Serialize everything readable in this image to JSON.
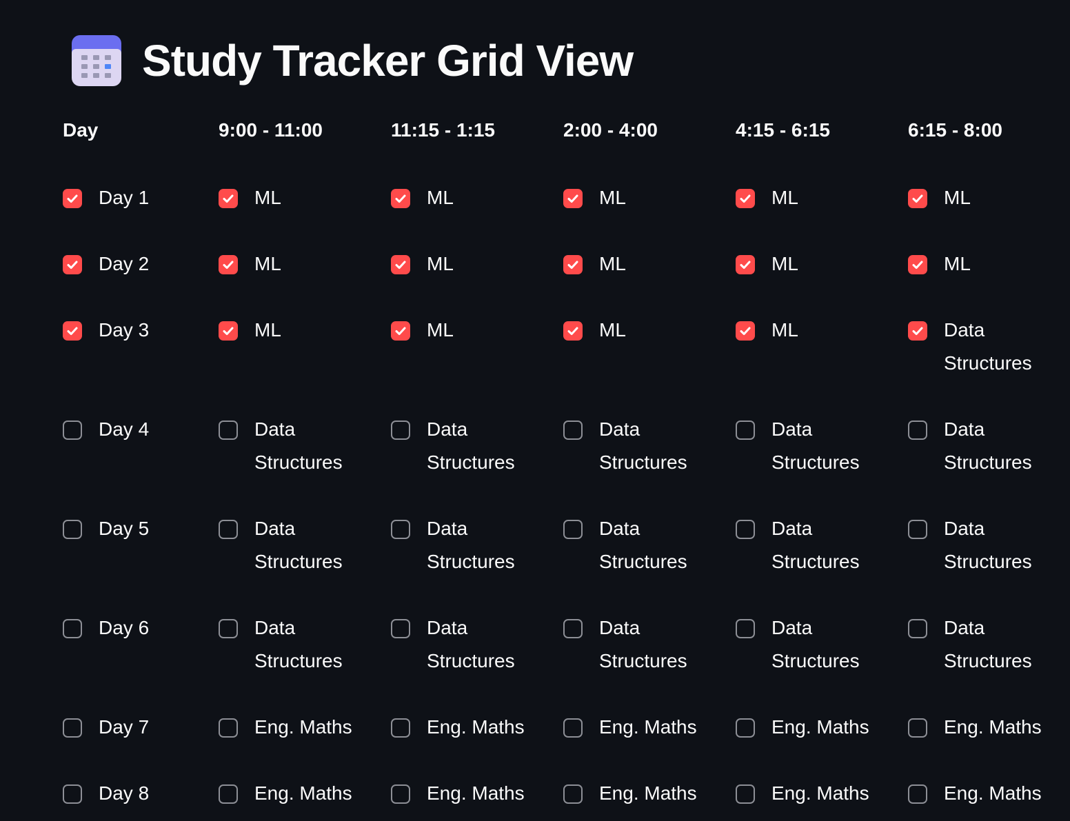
{
  "page": {
    "title": "Study Tracker Grid View",
    "title_icon": "calendar-icon"
  },
  "colors": {
    "background": "#0e1117",
    "checked": "#ff4b4b",
    "text": "#fafafa",
    "unchecked_border": "#8d8f96"
  },
  "grid": {
    "columns": [
      "Day",
      "9:00 - 11:00",
      "11:15 - 1:15",
      "2:00 - 4:00",
      "4:15 - 6:15",
      "6:15 - 8:00"
    ],
    "rows": [
      {
        "day": "Day 1",
        "day_checked": true,
        "slots": [
          {
            "label": "ML",
            "checked": true
          },
          {
            "label": "ML",
            "checked": true
          },
          {
            "label": "ML",
            "checked": true
          },
          {
            "label": "ML",
            "checked": true
          },
          {
            "label": "ML",
            "checked": true
          }
        ]
      },
      {
        "day": "Day 2",
        "day_checked": true,
        "slots": [
          {
            "label": "ML",
            "checked": true
          },
          {
            "label": "ML",
            "checked": true
          },
          {
            "label": "ML",
            "checked": true
          },
          {
            "label": "ML",
            "checked": true
          },
          {
            "label": "ML",
            "checked": true
          }
        ]
      },
      {
        "day": "Day 3",
        "day_checked": true,
        "slots": [
          {
            "label": "ML",
            "checked": true
          },
          {
            "label": "ML",
            "checked": true
          },
          {
            "label": "ML",
            "checked": true
          },
          {
            "label": "ML",
            "checked": true
          },
          {
            "label": "Data Structures",
            "checked": true
          }
        ]
      },
      {
        "day": "Day 4",
        "day_checked": false,
        "slots": [
          {
            "label": "Data Structures",
            "checked": false
          },
          {
            "label": "Data Structures",
            "checked": false
          },
          {
            "label": "Data Structures",
            "checked": false
          },
          {
            "label": "Data Structures",
            "checked": false
          },
          {
            "label": "Data Structures",
            "checked": false
          }
        ]
      },
      {
        "day": "Day 5",
        "day_checked": false,
        "slots": [
          {
            "label": "Data Structures",
            "checked": false
          },
          {
            "label": "Data Structures",
            "checked": false
          },
          {
            "label": "Data Structures",
            "checked": false
          },
          {
            "label": "Data Structures",
            "checked": false
          },
          {
            "label": "Data Structures",
            "checked": false
          }
        ]
      },
      {
        "day": "Day 6",
        "day_checked": false,
        "slots": [
          {
            "label": "Data Structures",
            "checked": false
          },
          {
            "label": "Data Structures",
            "checked": false
          },
          {
            "label": "Data Structures",
            "checked": false
          },
          {
            "label": "Data Structures",
            "checked": false
          },
          {
            "label": "Data Structures",
            "checked": false
          }
        ]
      },
      {
        "day": "Day 7",
        "day_checked": false,
        "slots": [
          {
            "label": "Eng. Maths",
            "checked": false
          },
          {
            "label": "Eng. Maths",
            "checked": false
          },
          {
            "label": "Eng. Maths",
            "checked": false
          },
          {
            "label": "Eng. Maths",
            "checked": false
          },
          {
            "label": "Eng. Maths",
            "checked": false
          }
        ]
      },
      {
        "day": "Day 8",
        "day_checked": false,
        "slots": [
          {
            "label": "Eng. Maths",
            "checked": false
          },
          {
            "label": "Eng. Maths",
            "checked": false
          },
          {
            "label": "Eng. Maths",
            "checked": false
          },
          {
            "label": "Eng. Maths",
            "checked": false
          },
          {
            "label": "Eng. Maths",
            "checked": false
          }
        ]
      }
    ]
  }
}
